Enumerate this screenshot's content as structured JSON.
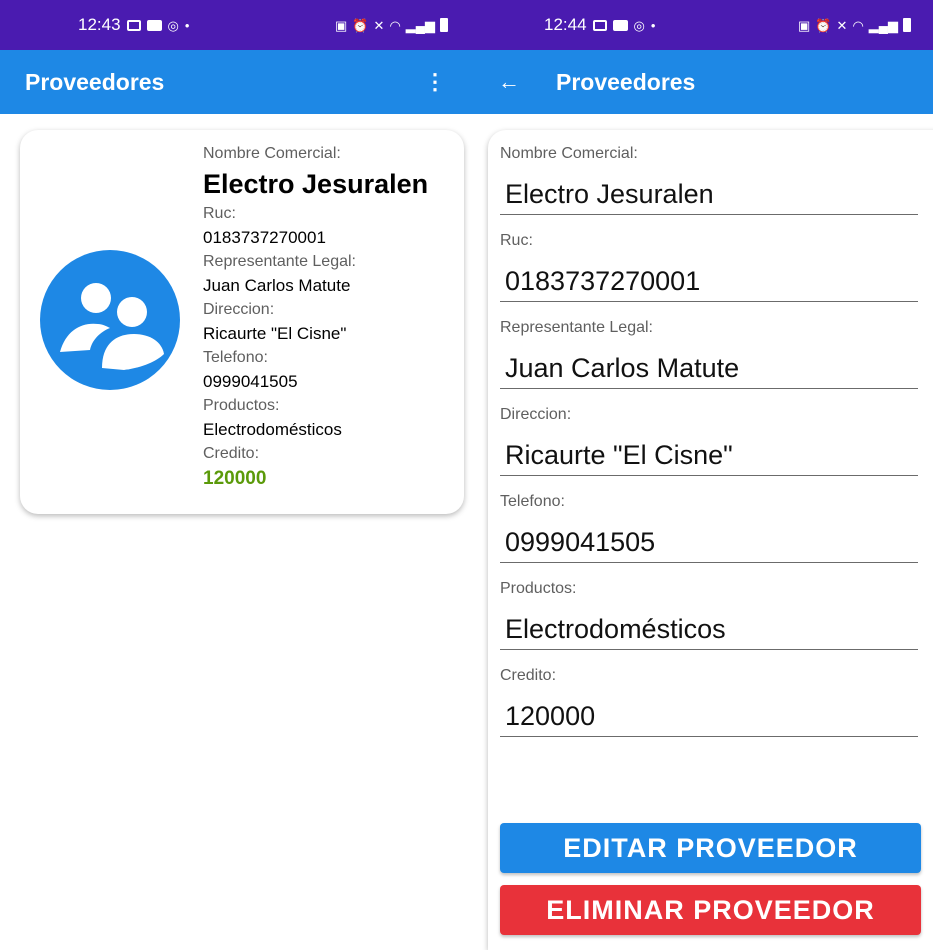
{
  "left": {
    "status_time": "12:43",
    "appbar_title": "Proveedores",
    "card": {
      "nombre_label": "Nombre Comercial:",
      "nombre": "Electro Jesuralen",
      "ruc_label": "Ruc:",
      "ruc": "0183737270001",
      "rep_label": "Representante Legal:",
      "rep": "Juan Carlos Matute",
      "dir_label": "Direccion:",
      "dir": "Ricaurte \"El Cisne\"",
      "tel_label": "Telefono:",
      "tel": "0999041505",
      "prod_label": "Productos:",
      "prod": "Electrodomésticos",
      "credito_label": "Credito:",
      "credito": "120000"
    }
  },
  "right": {
    "status_time": "12:44",
    "appbar_title": "Proveedores",
    "form": {
      "nombre_label": "Nombre Comercial:",
      "nombre": "Electro Jesuralen",
      "ruc_label": "Ruc:",
      "ruc": "0183737270001",
      "rep_label": "Representante Legal:",
      "rep": "Juan Carlos Matute",
      "dir_label": "Direccion:",
      "dir": "Ricaurte \"El Cisne\"",
      "tel_label": "Telefono:",
      "tel": "0999041505",
      "prod_label": "Productos:",
      "prod": "Electrodomésticos",
      "credito_label": "Credito:",
      "credito": "120000"
    },
    "edit_button": "EDITAR PROVEEDOR",
    "delete_button": "ELIMINAR PROVEEDOR"
  },
  "colors": {
    "status_bar": "#4a1bb0",
    "app_bar": "#1e88e5",
    "credit_green": "#5b9a0a",
    "edit_blue": "#1e88e5",
    "delete_red": "#e8323a"
  },
  "icons": {
    "avatar": "group-people-icon",
    "menu": "more-vertical-icon",
    "back": "arrow-back-icon"
  }
}
